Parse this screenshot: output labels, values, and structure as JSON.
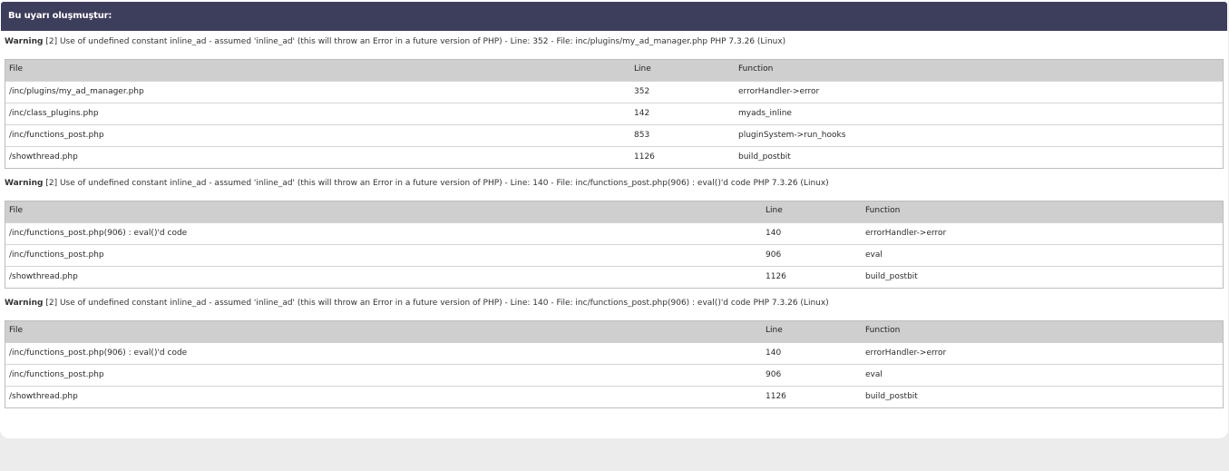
{
  "header": {
    "title": "Bu uyarı oluşmuştur:"
  },
  "columns": {
    "file": "File",
    "line": "Line",
    "function": "Function"
  },
  "warnings": [
    {
      "label": "Warning",
      "message": "[2] Use of undefined constant inline_ad - assumed 'inline_ad' (this will throw an Error in a future version of PHP) - Line: 352 - File: inc/plugins/my_ad_manager.php PHP 7.3.26 (Linux)",
      "rows": [
        {
          "file": "/inc/plugins/my_ad_manager.php",
          "line": "352",
          "function": "errorHandler->error"
        },
        {
          "file": "/inc/class_plugins.php",
          "line": "142",
          "function": "myads_inline"
        },
        {
          "file": "/inc/functions_post.php",
          "line": "853",
          "function": "pluginSystem->run_hooks"
        },
        {
          "file": "/showthread.php",
          "line": "1126",
          "function": "build_postbit"
        }
      ]
    },
    {
      "label": "Warning",
      "message": "[2] Use of undefined constant inline_ad - assumed 'inline_ad' (this will throw an Error in a future version of PHP) - Line: 140 - File: inc/functions_post.php(906) : eval()'d code PHP 7.3.26 (Linux)",
      "rows": [
        {
          "file": "/inc/functions_post.php(906) : eval()'d code",
          "line": "140",
          "function": "errorHandler->error"
        },
        {
          "file": "/inc/functions_post.php",
          "line": "906",
          "function": "eval"
        },
        {
          "file": "/showthread.php",
          "line": "1126",
          "function": "build_postbit"
        }
      ]
    },
    {
      "label": "Warning",
      "message": "[2] Use of undefined constant inline_ad - assumed 'inline_ad' (this will throw an Error in a future version of PHP) - Line: 140 - File: inc/functions_post.php(906) : eval()'d code PHP 7.3.26 (Linux)",
      "rows": [
        {
          "file": "/inc/functions_post.php(906) : eval()'d code",
          "line": "140",
          "function": "errorHandler->error"
        },
        {
          "file": "/inc/functions_post.php",
          "line": "906",
          "function": "eval"
        },
        {
          "file": "/showthread.php",
          "line": "1126",
          "function": "build_postbit"
        }
      ]
    }
  ]
}
